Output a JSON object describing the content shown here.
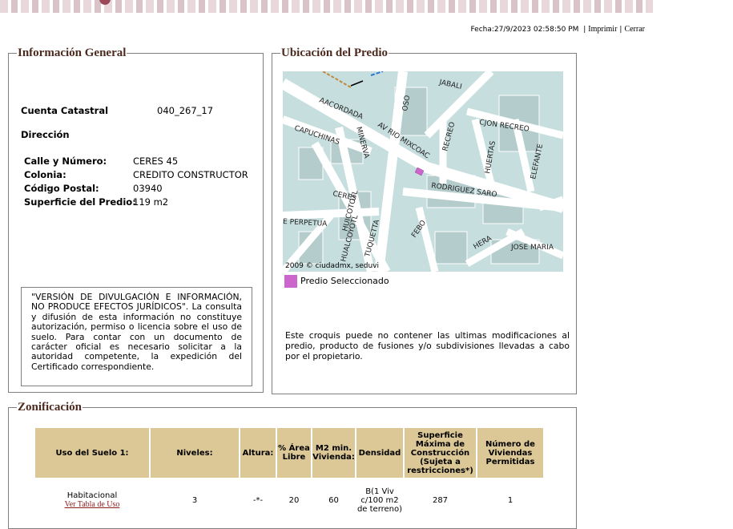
{
  "header": {
    "fecha": "Fecha:27/9/2023 02:58:50 PM",
    "separator": "|",
    "imprimir": "Imprimir",
    "cerrar": "Cerrar"
  },
  "info_general": {
    "title": "Información General",
    "cuenta_catastral_label": "Cuenta Catastral",
    "cuenta_catastral_value": "040_267_17",
    "direccion_label": "Dirección",
    "calle_label": "Calle y Número:",
    "calle_value": "CERES 45",
    "colonia_label": "Colonia:",
    "colonia_value": "CREDITO CONSTRUCTOR",
    "cp_label": "Código Postal:",
    "cp_value": "03940",
    "superficie_label": "Superficie del Predio:",
    "superficie_value": "119 m2",
    "disclaimer": "\"VERSIÓN DE DIVULGACIÓN E INFORMACIÓN, NO PRODUCE EFECTOS JURÍDICOS\". La consulta y difusión de esta información no constituye autorización, permiso o licencia sobre el uso de suelo. Para contar con un documento de carácter oficial es necesario solicitar a la autoridad competente, la expedición del Certificado correspondiente."
  },
  "ubicacion": {
    "title": "Ubicación del Predio",
    "map": {
      "credit": "2009 © ciudadmx, seduvi",
      "street_labels": {
        "jabali": "JABALI",
        "oso": "OSO",
        "acordada": "AACORDADA",
        "av_rio": "AV RIO MIXCOAC",
        "capuchinas": "CAPUCHINAS",
        "minerva": "MINERVA",
        "recreo": "RECREO",
        "cjon_recreo": "CJON RECREO",
        "huertas": "HUERTAS",
        "elefante": "ELEFANTE",
        "rodriguez": "RODRIGUEZ SARO",
        "ceres": "CERES",
        "perpetua": "E PERPETUA",
        "huico": "HUICOTOTL",
        "hualco": "HUALCOYOTL",
        "tuquetta": "TUQUETTA",
        "febo": "FEBO",
        "hera": "HERA",
        "jose_maria": "JOSE MARIA"
      },
      "colors": {
        "background": "#c6dede",
        "streets": "#ffffff",
        "blocks": "#b4cccc",
        "selected": "#cc66cc"
      }
    },
    "legend_label": "Predio Seleccionado",
    "croquis_note": "Este croquis puede no contener las ultimas modificaciones al predio, producto de fusiones y/o subdivisiones llevadas a cabo por el propietario."
  },
  "zonificacion": {
    "title": "Zonificación",
    "headers": {
      "uso": "Uso del Suelo 1:",
      "niveles": "Niveles:",
      "altura": "Altura:",
      "area_libre": "% Área Libre",
      "m2_min": "M2 min. Vivienda:",
      "densidad": "Densidad",
      "superficie_max": "Superficie Máxima de Construcción (Sujeta a restricciones*)",
      "num_viviendas": "Número de Viviendas Permitidas"
    },
    "row": {
      "uso": "Habitacional",
      "uso_link": "Ver Tabla de Uso",
      "niveles": "3",
      "altura": "-*-",
      "area_libre": "20",
      "m2_min": "60",
      "densidad": "B(1 Viv c/100 m2 de terreno)",
      "superficie_max": "287",
      "num_viviendas": "1"
    },
    "header_color": "#dcc897"
  }
}
